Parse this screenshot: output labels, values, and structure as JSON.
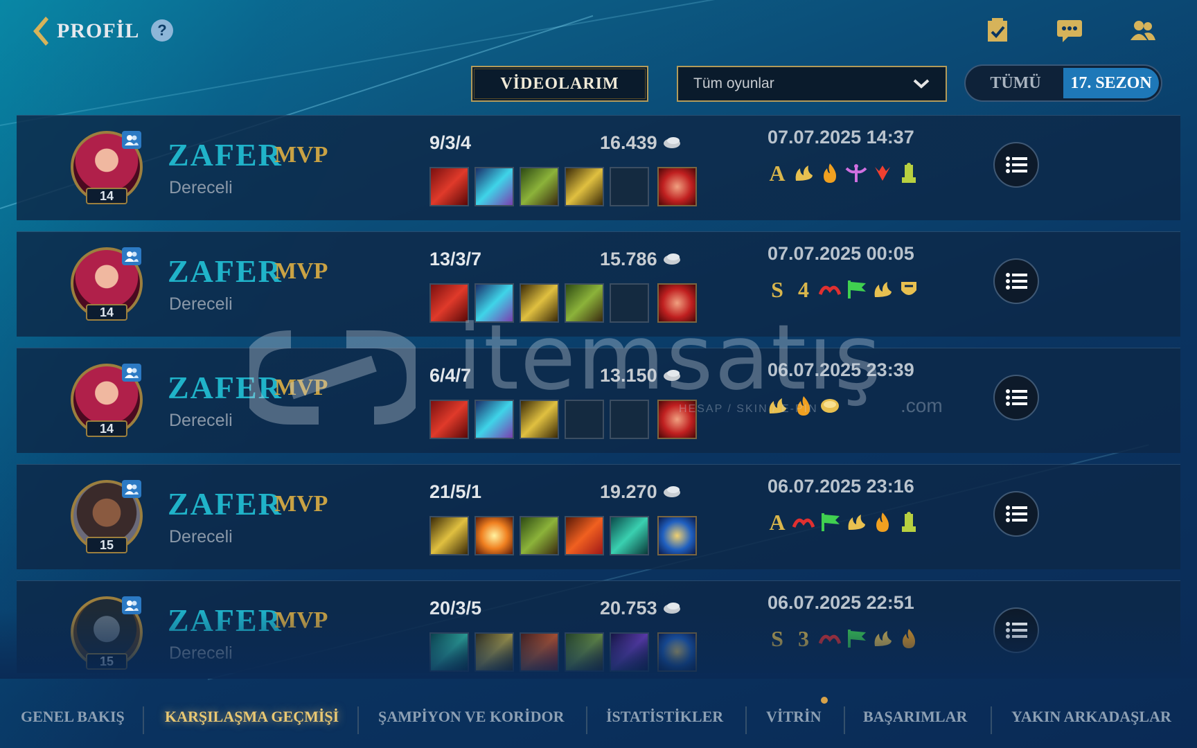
{
  "header": {
    "back_label": "PROFİL",
    "help_glyph": "?",
    "icons": [
      "checklist-icon",
      "chat-icon",
      "friends-icon"
    ]
  },
  "controls": {
    "videos_label": "VİDEOLARIM",
    "filter_selected": "Tüm oyunlar",
    "toggle": {
      "all": "TÜMÜ",
      "season": "17. SEZON",
      "active": "season"
    }
  },
  "matches": [
    {
      "player": "ZAFER",
      "mvp": "MVP",
      "queue": "Dereceli",
      "level": "14",
      "champion": "portrait-red-hair",
      "kda": "9/3/4",
      "gold": "16.439",
      "date": "07.07.2025",
      "time": "14:37",
      "items": [
        "red-item",
        "crystal-item",
        "green-item",
        "gold-sword-item",
        "empty",
        "trinket-red"
      ],
      "badges": [
        "A",
        "flame-gold",
        "fire",
        "angel",
        "red-claw",
        "totem"
      ]
    },
    {
      "player": "ZAFER",
      "mvp": "MVP",
      "queue": "Dereceli",
      "level": "14",
      "champion": "portrait-red-hair",
      "kda": "13/3/7",
      "gold": "15.786",
      "date": "07.07.2025",
      "time": "00:05",
      "items": [
        "red-item",
        "crystal-item",
        "gold-sword-item",
        "green-item",
        "empty",
        "trinket-red"
      ],
      "badges": [
        "S",
        "4",
        "red-swirl",
        "flag",
        "flame-gold",
        "shield"
      ]
    },
    {
      "player": "ZAFER",
      "mvp": "MVP",
      "queue": "Dereceli",
      "level": "14",
      "champion": "portrait-red-hair",
      "kda": "6/4/7",
      "gold": "13.150",
      "date": "06.07.2025",
      "time": "23:39",
      "items": [
        "red-item",
        "crystal-item",
        "gold-sword-item",
        "empty",
        "empty",
        "trinket-red"
      ],
      "badges": [
        "flame-gold",
        "fire",
        "coin"
      ]
    },
    {
      "player": "ZAFER",
      "mvp": "MVP",
      "queue": "Dereceli",
      "level": "15",
      "champion": "portrait-dark-warrior",
      "kda": "21/5/1",
      "gold": "19.270",
      "date": "06.07.2025",
      "time": "23:16",
      "items": [
        "gold-sword-item",
        "orange-burst",
        "green-item",
        "fire-item",
        "teal-item",
        "trinket-blue"
      ],
      "badges": [
        "A",
        "red-swirl",
        "flag",
        "flame-gold",
        "fire",
        "totem"
      ]
    },
    {
      "player": "ZAFER",
      "mvp": "MVP",
      "queue": "Dereceli",
      "level": "15",
      "champion": "portrait-armored",
      "kda": "20/3/5",
      "gold": "20.753",
      "date": "06.07.2025",
      "time": "22:51",
      "items": [
        "teal-item",
        "gold-sword-item",
        "fire-item",
        "green-item",
        "purple-item",
        "trinket-blue"
      ],
      "badges": [
        "S",
        "3",
        "red-swirl",
        "flag",
        "flame-gold",
        "fire"
      ]
    }
  ],
  "watermark": {
    "text": "itemsatış",
    "sub": "HESAP / SKIN / E-PIN",
    "dotcom": ".com"
  },
  "nav": {
    "tabs": [
      "GENEL BAKIŞ",
      "KARŞILAŞMA GEÇMİŞİ",
      "ŞAMPİYON VE KORİDOR",
      "İSTATİSTİKLER",
      "VİTRİN",
      "BAŞARIMLAR",
      "YAKIN ARKADAŞLAR"
    ],
    "active": "KARŞILAŞMA GEÇMİŞİ"
  },
  "colors": {
    "accent": "#20b3c9",
    "gold": "#c9a244",
    "active_tab": "#e9c873",
    "toggle_active": "#1e78b8"
  }
}
